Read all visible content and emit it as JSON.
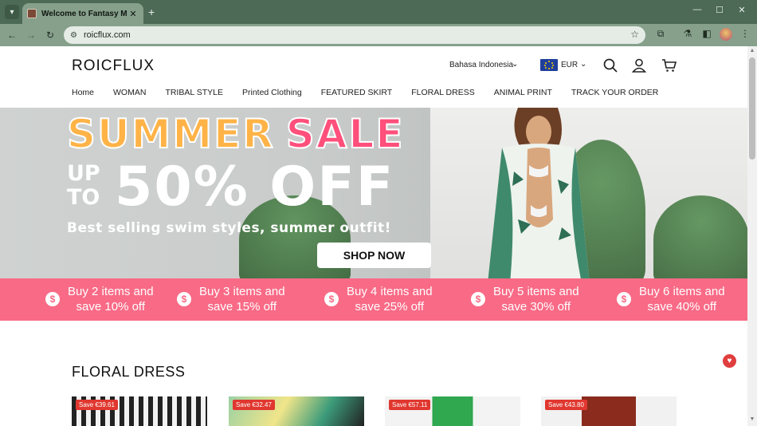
{
  "browser": {
    "tab_title": "Welcome to Fantasy Mall",
    "url": "roicflux.com",
    "icons": [
      "tab-list-icon",
      "favicon",
      "close-icon",
      "new-tab-icon",
      "minimize-icon",
      "maximize-icon",
      "window-close-icon",
      "back-icon",
      "forward-icon",
      "reload-icon",
      "site-info-icon",
      "bookmark-star-icon",
      "extensions-icon",
      "labs-icon",
      "sidebar-icon",
      "profile-avatar",
      "menu-icon"
    ]
  },
  "header": {
    "logo": "ROICFLUX",
    "language": "Bahasa Indonesia",
    "currency": "EUR",
    "icons": [
      "search-icon",
      "account-icon",
      "cart-icon"
    ]
  },
  "nav": {
    "items": [
      "Home",
      "WOMAN",
      "TRIBAL STYLE",
      "Printed Clothing",
      "FEATURED SKIRT",
      "FLORAL DRESS",
      "ANIMAL PRINT",
      "TRACK YOUR ORDER"
    ]
  },
  "banner": {
    "headline_1": "SUMMER",
    "headline_2": "SALE",
    "up": "UP",
    "to": "TO",
    "discount": "50% OFF",
    "subtitle": "Best selling swim styles, summer outfit!",
    "cta": "SHOP NOW"
  },
  "promo": {
    "items": [
      {
        "line1": "Buy 2 items and",
        "line2": "save 10% off"
      },
      {
        "line1": "Buy 3 items and",
        "line2": "save 15% off"
      },
      {
        "line1": "Buy 4 items and",
        "line2": "save 25% off"
      },
      {
        "line1": "Buy 5 items and",
        "line2": "save 30% off"
      },
      {
        "line1": "Buy 6 items and",
        "line2": "save 40% off"
      }
    ]
  },
  "section": {
    "title": "FLORAL DRESS"
  },
  "products": [
    {
      "badge": "Save €39.61"
    },
    {
      "badge": "Save €32.47"
    },
    {
      "badge": "Save €57.11"
    },
    {
      "badge": "Save €43.80"
    }
  ],
  "colors": {
    "promo_bar": "#f96a86",
    "badge": "#e0372f",
    "chrome": "#4c6a56"
  }
}
